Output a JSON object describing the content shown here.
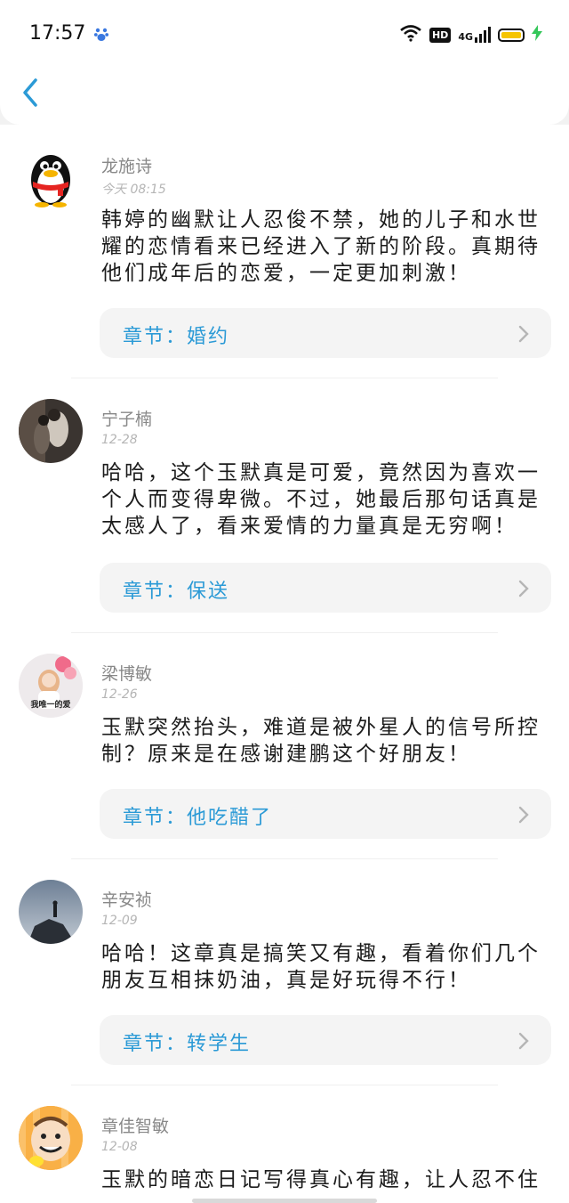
{
  "status": {
    "time": "17:57",
    "hd": "HD",
    "network": "4G"
  },
  "comments": [
    {
      "name": "龙施诗",
      "date": "今天 08:15",
      "text": "韩婷的幽默让人忍俊不禁，她的儿子和水世耀的恋情看来已经进入了新的阶段。真期待他们成年后的恋爱，一定更加刺激！",
      "chapter": "章节：婚约",
      "avatar": "qq-penguin-avatar"
    },
    {
      "name": "宁子楠",
      "date": "12-28",
      "text": "哈哈，这个玉默真是可爱，竟然因为喜欢一个人而变得卑微。不过，她最后那句话真是太感人了，看来爱情的力量真是无穷啊！",
      "chapter": "章节：保送",
      "avatar": "couple-photo-avatar"
    },
    {
      "name": "梁博敏",
      "date": "12-26",
      "text": "玉默突然抬头，难道是被外星人的信号所控制？原来是在感谢建鹏这个好朋友！",
      "chapter": "章节：他吃醋了",
      "avatar": "girl-balloon-avatar",
      "avatar_caption": "我唯一的爱"
    },
    {
      "name": "辛安祯",
      "date": "12-09",
      "text": "哈哈！这章真是搞笑又有趣，看着你们几个朋友互相抹奶油，真是好玩得不行！",
      "chapter": "章节：转学生",
      "avatar": "silhouette-avatar"
    },
    {
      "name": "章佳智敏",
      "date": "12-08",
      "text": "玉默的暗恋日记写得真心有趣，让人忍不住",
      "chapter": "",
      "avatar": "cartoon-face-avatar"
    }
  ],
  "colors": {
    "accent": "#2b9ad6",
    "battery": "#f5c400",
    "charging": "#34c759"
  }
}
